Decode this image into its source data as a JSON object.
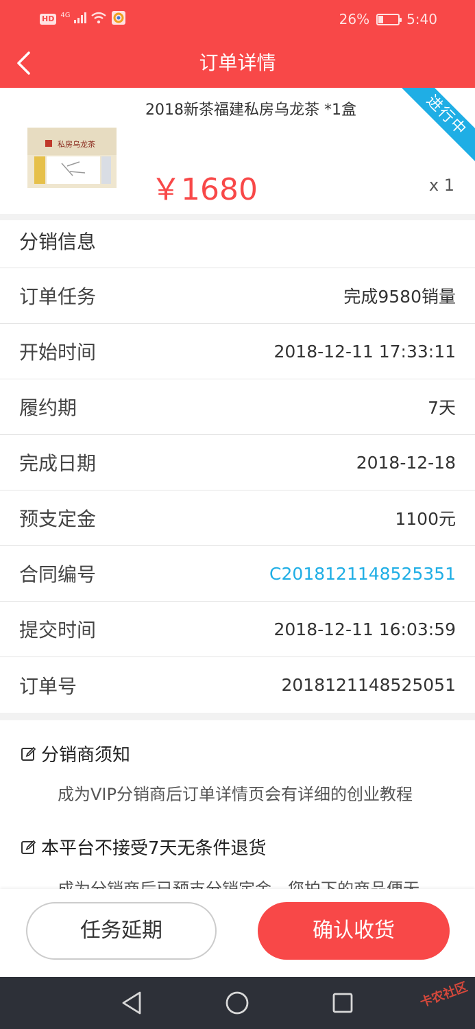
{
  "status_bar": {
    "hd": "HD",
    "network": "4G",
    "battery_text": "26%",
    "battery_level": 0.26,
    "time": "5:40"
  },
  "nav": {
    "title": "订单详情",
    "back_icon": "chevron-left-icon"
  },
  "product": {
    "title": "2018新茶福建私房乌龙茶 *1盒",
    "price": "￥1680",
    "quantity": "x 1",
    "status_ribbon": "进行中",
    "image_label": "私房乌龙茶"
  },
  "info": {
    "header": "分销信息",
    "rows": [
      {
        "label": "订单任务",
        "value": "完成9580销量"
      },
      {
        "label": "开始时间",
        "value": "2018-12-11 17:33:11"
      },
      {
        "label": "履约期",
        "value": "7天"
      },
      {
        "label": "完成日期",
        "value": "2018-12-18"
      },
      {
        "label": "预支定金",
        "value": "1100元"
      },
      {
        "label": "合同编号",
        "value": "C2018121148525351"
      },
      {
        "label": "提交时间",
        "value": "2018-12-11 16:03:59"
      },
      {
        "label": "订单号",
        "value": "2018121148525051"
      }
    ]
  },
  "notice": {
    "section1_title": "分销商须知",
    "section1_body": "成为VIP分销商后订单详情页会有详细的创业教程",
    "section2_title": "本平台不接受7天无条件退货",
    "section2_body": "成为分销商后已预支分销定金，您拍下的商品便无"
  },
  "actions": {
    "delay_label": "任务延期",
    "confirm_label": "确认收货"
  },
  "watermark": "卡农社区",
  "colors": {
    "brand_red": "#f84848",
    "link_blue": "#1faee5"
  }
}
